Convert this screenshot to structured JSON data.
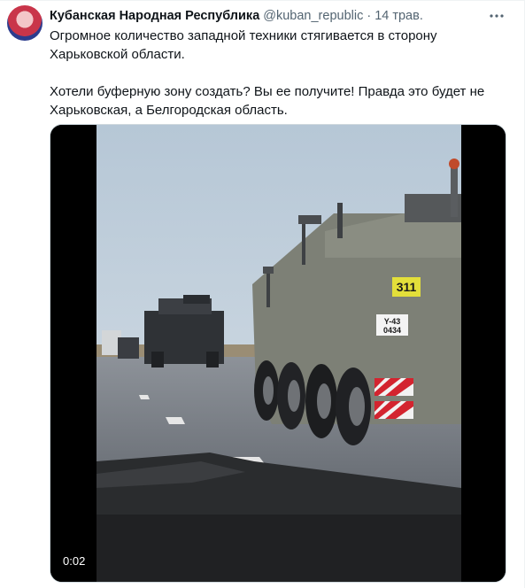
{
  "tweet": {
    "author_name": "Кубанская Народная Республика",
    "handle": "@kuban_republic",
    "separator": "·",
    "timestamp": "14 трав.",
    "more_icon": "more-horizontal-icon",
    "text_line1": "Огромное количество западной техники стягивается в сторону Харьковской области.",
    "text_line2": "Хотели буферную зону создать? Вы ее получите! Правда это будет не Харьковская, а Белгородская область."
  },
  "video": {
    "duration": "0:02",
    "vehicle_number": "311",
    "plate_line1": "Y-43",
    "plate_line2": "0434"
  },
  "colors": {
    "text_primary": "#0f1419",
    "text_secondary": "#536471",
    "border": "#eff3f4"
  }
}
